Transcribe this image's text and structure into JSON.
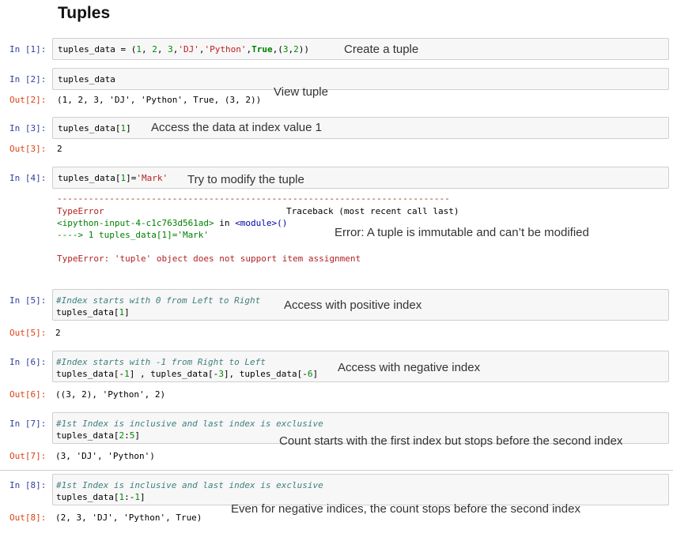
{
  "title": "Tuples",
  "cells": [
    {
      "prompt": "In [1]:",
      "code": "tuples_data = (1, 2, 3,'DJ','Python',True,(3,2))",
      "note": "Create a tuple"
    },
    {
      "prompt": "In [2]:",
      "code": "tuples_data",
      "out_prompt": "Out[2]:",
      "output": "(1, 2, 3, 'DJ', 'Python', True, (3, 2))",
      "note": "View tuple"
    },
    {
      "prompt": "In [3]:",
      "code": "tuples_data[1]",
      "out_prompt": "Out[3]:",
      "output": "2",
      "note": "Access the data at index value 1"
    },
    {
      "prompt": "In [4]:",
      "code": "tuples_data[1]='Mark'",
      "note": "Try to modify the tuple",
      "traceback": {
        "dashes": "---------------------------------------------------------------------------",
        "error_name": "TypeError",
        "traceback_label": "Traceback (most recent call last)",
        "input_ref": "<ipython-input-4-c1c763d561ad>",
        "in_text": " in ",
        "module_ref": "<module>()",
        "arrow_line": "----> 1 tuples_data[1]='Mark'",
        "message": "TypeError: 'tuple' object does not support item assignment"
      },
      "error_note": "Error: A tuple is immutable and can’t be modified"
    },
    {
      "prompt": "In [5]:",
      "comment": "#Index starts with 0 from Left to Right",
      "code": "tuples_data[1]",
      "out_prompt": "Out[5]:",
      "output": "2",
      "note": "Access with positive index"
    },
    {
      "prompt": "In [6]:",
      "comment": "#Index starts with -1 from Right to Left",
      "code": "tuples_data[-1] , tuples_data[-3], tuples_data[-6]",
      "out_prompt": "Out[6]:",
      "output": "((3, 2), 'Python', 2)",
      "note": "Access with negative index"
    },
    {
      "prompt": "In [7]:",
      "comment": "#1st Index is inclusive and last index is exclusive",
      "code": "tuples_data[2:5]",
      "out_prompt": "Out[7]:",
      "output": "(3, 'DJ', 'Python')",
      "note": "Count starts with the first index but stops before the second index"
    },
    {
      "prompt": "In [8]:",
      "comment": "#1st Index is inclusive and last index is exclusive",
      "code": "tuples_data[1:-1]",
      "out_prompt": "Out[8]:",
      "output": "(2, 3, 'DJ', 'Python', True)",
      "note": "Even for negative indices, the count stops before the second index"
    }
  ],
  "colors": {
    "in_prompt": "#303f9f",
    "out_prompt": "#d84315",
    "cell_bg": "#f7f7f7",
    "cell_border": "#cfcfcf"
  }
}
